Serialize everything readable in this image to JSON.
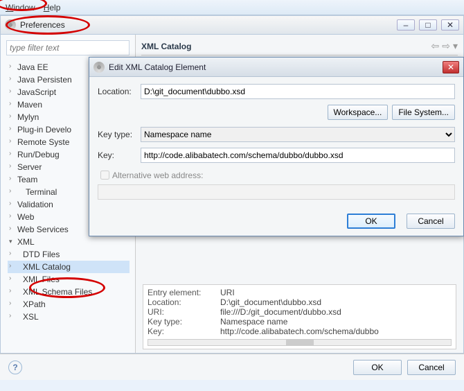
{
  "menu": {
    "window": "Window",
    "help": "Help"
  },
  "prefs": {
    "title": "Preferences"
  },
  "window_controls": {
    "min": "–",
    "max": "□",
    "close": "✕"
  },
  "filter": {
    "placeholder": "type filter text"
  },
  "tree": {
    "items": [
      "Java EE",
      "Java Persisten",
      "JavaScript",
      "Maven",
      "Mylyn",
      "Plug-in Develo",
      "Remote Syste",
      "Run/Debug",
      "Server",
      "Team",
      "Terminal",
      "Validation",
      "Web",
      "Web Services"
    ],
    "xml": {
      "label": "XML",
      "children": [
        "DTD Files",
        "XML Catalog",
        "XML Files",
        "XML Schema Files",
        "XPath",
        "XSL"
      ]
    }
  },
  "right": {
    "title": "XML Catalog",
    "nav": {
      "back": "⇦",
      "fwd": "⇨",
      "menu": "▾"
    }
  },
  "dialog": {
    "title": "Edit XML Catalog Element",
    "close": "✕",
    "location_label": "Location:",
    "location_value": "D:\\git_document\\dubbo.xsd",
    "workspace_btn": "Workspace...",
    "filesystem_btn": "File System...",
    "keytype_label": "Key type:",
    "keytype_value": "Namespace name",
    "key_label": "Key:",
    "key_value": "http://code.alibabatech.com/schema/dubbo/dubbo.xsd",
    "alt_label": "Alternative web address:",
    "ok": "OK",
    "cancel": "Cancel"
  },
  "details": {
    "rows": [
      {
        "label": "Entry element:",
        "value": "URI"
      },
      {
        "label": "Location:",
        "value": "D:\\git_document\\dubbo.xsd"
      },
      {
        "label": "URI:",
        "value": "file:///D:/git_document/dubbo.xsd"
      },
      {
        "label": "Key type:",
        "value": "Namespace name"
      },
      {
        "label": "Key:",
        "value": "http://code.alibabatech.com/schema/dubbo"
      }
    ]
  },
  "bottom": {
    "ok": "OK",
    "cancel": "Cancel",
    "help": "?"
  }
}
